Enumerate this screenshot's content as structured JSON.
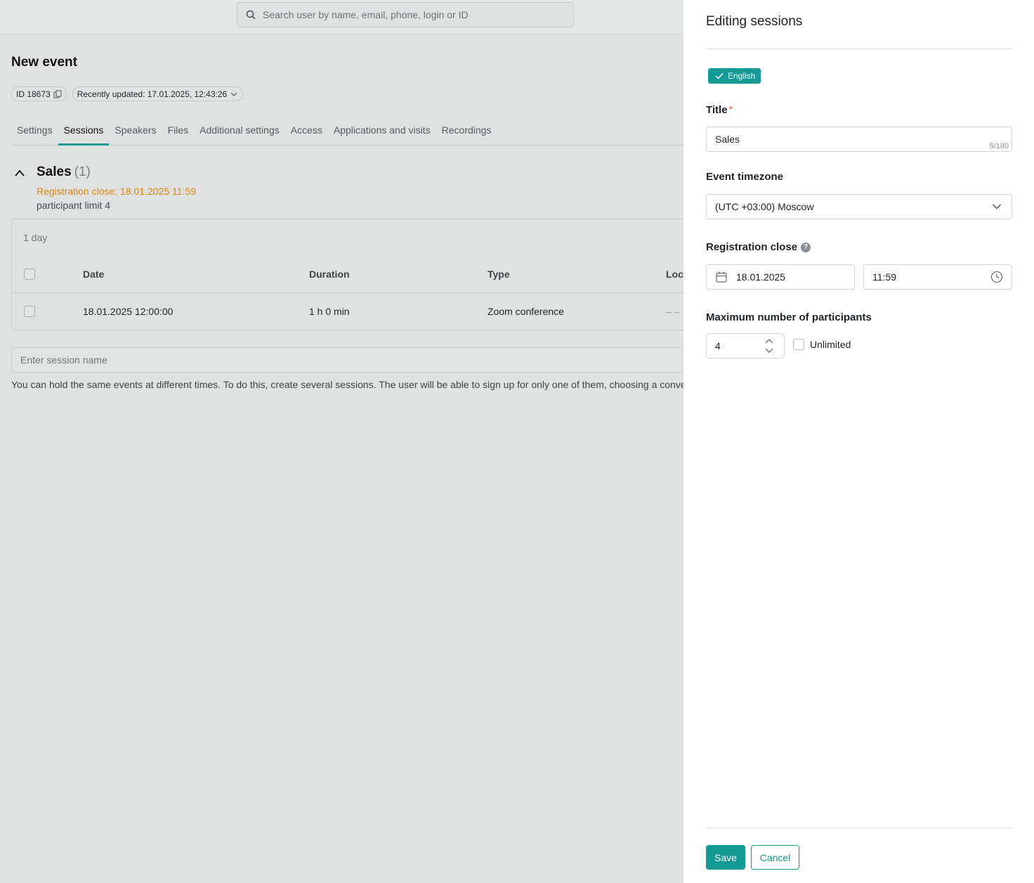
{
  "search": {
    "placeholder": "Search user by name, email, phone, login or ID"
  },
  "page": {
    "title": "New event",
    "id_label": "ID 18673",
    "updated_label": "Recently updated: 17.01.2025, 12:43:26"
  },
  "tabs": [
    {
      "label": "Settings",
      "active": false
    },
    {
      "label": "Sessions",
      "active": true
    },
    {
      "label": "Speakers",
      "active": false
    },
    {
      "label": "Files",
      "active": false
    },
    {
      "label": "Additional settings",
      "active": false
    },
    {
      "label": "Access",
      "active": false
    },
    {
      "label": "Applications and visits",
      "active": false
    },
    {
      "label": "Recordings",
      "active": false
    }
  ],
  "session_group": {
    "title": "Sales",
    "count": "(1)",
    "registration_close": "Registration close: 18.01.2025 11:59",
    "participant_limit": "participant limit 4",
    "day_label": "1 day",
    "columns": [
      "Date",
      "Duration",
      "Type",
      "Loca"
    ],
    "rows": [
      {
        "date": "18.01.2025 12:00:00",
        "duration": "1 h 0 min",
        "type": "Zoom conference",
        "location": "– –"
      }
    ]
  },
  "new_session": {
    "placeholder": "Enter session name",
    "hint": "You can hold the same events at different times. To do this, create several sessions. The user will be able to sign up for only one of them, choosing a conve"
  },
  "drawer": {
    "title": "Editing sessions",
    "language_tag": "English",
    "title_label": "Title",
    "title_value": "Sales",
    "title_counter": "5/180",
    "timezone_label": "Event timezone",
    "timezone_value": "(UTC +03:00) Moscow",
    "reg_close_label": "Registration close",
    "reg_close_date": "18.01.2025",
    "reg_close_time": "11:59",
    "max_label": "Maximum number of participants",
    "max_value": "4",
    "unlimited_label": "Unlimited",
    "save_label": "Save",
    "cancel_label": "Cancel"
  },
  "colors": {
    "accent": "#139a95",
    "warning": "#e1850a"
  }
}
